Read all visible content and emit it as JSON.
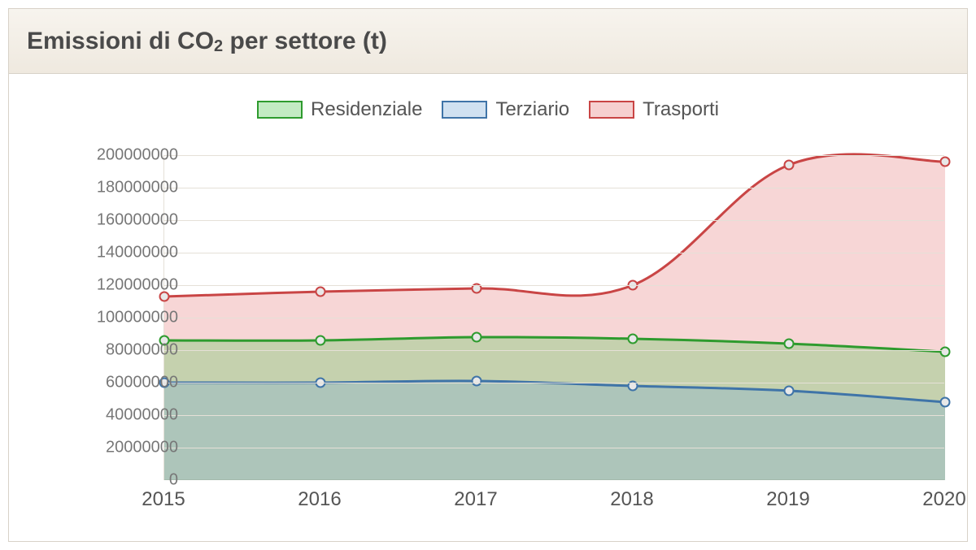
{
  "title_html": "Emissioni di CO<sub>2</sub> per settore (t)",
  "legend": {
    "residenziale": "Residenziale",
    "terziario": "Terziario",
    "trasporti": "Trasporti"
  },
  "chart_data": {
    "type": "area",
    "x": [
      2015,
      2016,
      2017,
      2018,
      2019,
      2020
    ],
    "series": [
      {
        "name": "Residenziale",
        "values": [
          86000000,
          86000000,
          88000000,
          87000000,
          84000000,
          79000000
        ],
        "color": "#2e9b2e",
        "fill": "rgba(83,199,83,0.30)"
      },
      {
        "name": "Terziario",
        "values": [
          60000000,
          60000000,
          61000000,
          58000000,
          55000000,
          48000000
        ],
        "color": "#3f74a8",
        "fill": "rgba(120,170,215,0.30)"
      },
      {
        "name": "Trasporti",
        "values": [
          113000000,
          116000000,
          118000000,
          120000000,
          194000000,
          196000000
        ],
        "color": "#c94545",
        "fill": "rgba(230,120,120,0.30)"
      }
    ],
    "title": "Emissioni di CO2 per settore (t)",
    "xlabel": "",
    "ylabel": "",
    "ylim": [
      0,
      200000000
    ],
    "y_ticks": [
      0,
      20000000,
      40000000,
      60000000,
      80000000,
      100000000,
      120000000,
      140000000,
      160000000,
      180000000,
      200000000
    ]
  }
}
